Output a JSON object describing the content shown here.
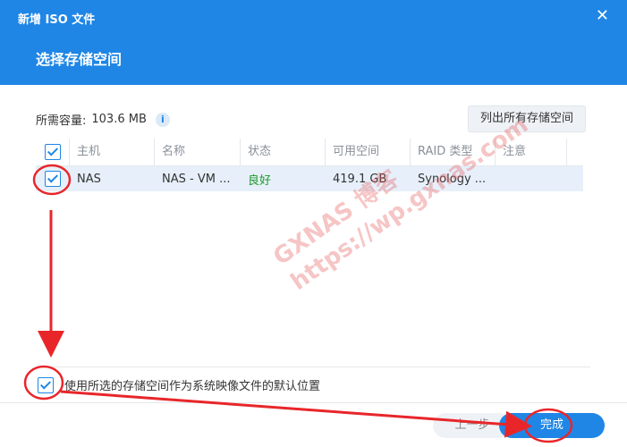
{
  "window": {
    "title": "新增 ISO 文件",
    "close_glyph": "✕",
    "section_title": "选择存储空间"
  },
  "storage": {
    "required_label": "所需容量:",
    "required_value": "103.6 MB",
    "info_glyph": "i",
    "list_all_button": "列出所有存储空间"
  },
  "table": {
    "headers": [
      "主机",
      "名称",
      "状态",
      "可用空间",
      "RAID 类型",
      "注意"
    ],
    "rows": [
      {
        "host": "NAS",
        "name": "NAS - VM ...",
        "status": "良好",
        "free": "419.1 GB",
        "raid": "Synology ...",
        "note": ""
      }
    ]
  },
  "options": {
    "default_location_label": "使用所选的存储空间作为系统映像文件的默认位置"
  },
  "footer": {
    "prev_button": "上一步",
    "finish_button": "完成"
  },
  "watermark": {
    "line1": "GXNAS 博客",
    "line2": "https://wp.gxnas.com"
  },
  "colors": {
    "accent": "#1f86e6",
    "status_good": "#1a9a2a",
    "annotation": "#e8262a"
  }
}
